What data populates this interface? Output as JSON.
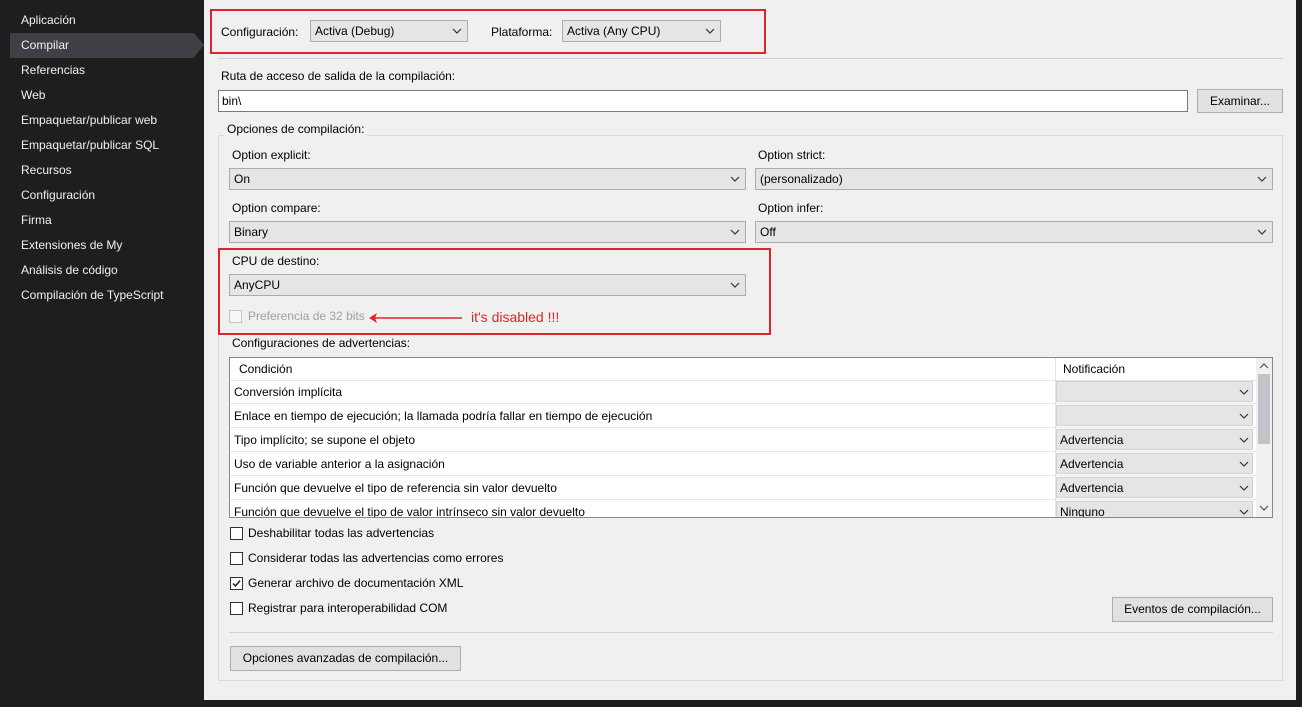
{
  "sidebar": {
    "items": [
      {
        "label": "Aplicación",
        "active": false
      },
      {
        "label": "Compilar",
        "active": true
      },
      {
        "label": "Referencias",
        "active": false
      },
      {
        "label": "Web",
        "active": false
      },
      {
        "label": "Empaquetar/publicar web",
        "active": false
      },
      {
        "label": "Empaquetar/publicar SQL",
        "active": false
      },
      {
        "label": "Recursos",
        "active": false
      },
      {
        "label": "Configuración",
        "active": false
      },
      {
        "label": "Firma",
        "active": false
      },
      {
        "label": "Extensiones de My",
        "active": false
      },
      {
        "label": "Análisis de código",
        "active": false
      },
      {
        "label": "Compilación de TypeScript",
        "active": false
      }
    ]
  },
  "top": {
    "config_label": "Configuración:",
    "config_value": "Activa (Debug)",
    "platform_label": "Plataforma:",
    "platform_value": "Activa (Any CPU)"
  },
  "output": {
    "label": "Ruta de acceso de salida de la compilación:",
    "value": "bin\\",
    "browse_button": "Examinar..."
  },
  "options": {
    "group_label": "Opciones de compilación:",
    "explicit_label": "Option explicit:",
    "explicit_value": "On",
    "strict_label": "Option strict:",
    "strict_value": "(personalizado)",
    "compare_label": "Option compare:",
    "compare_value": "Binary",
    "infer_label": "Option infer:",
    "infer_value": "Off",
    "cpu_label": "CPU de destino:",
    "cpu_value": "AnyCPU",
    "prefer32_label": "Preferencia de 32 bits",
    "prefer32_checked": false,
    "prefer32_enabled": false
  },
  "annotation": {
    "text": "it's disabled !!!",
    "color": "#e0242b"
  },
  "warnings": {
    "label": "Configuraciones de advertencias:",
    "col_condition": "Condición",
    "col_notification": "Notificación",
    "rows": [
      {
        "condition": "Conversión implícita",
        "notification": ""
      },
      {
        "condition": "Enlace en tiempo de ejecución; la llamada podría fallar en tiempo de ejecución",
        "notification": ""
      },
      {
        "condition": "Tipo implícito; se supone el objeto",
        "notification": "Advertencia"
      },
      {
        "condition": "Uso de variable anterior a la asignación",
        "notification": "Advertencia"
      },
      {
        "condition": "Función que devuelve el tipo de referencia sin valor devuelto",
        "notification": "Advertencia"
      },
      {
        "condition": "Función que devuelve el tipo de valor intrínseco sin valor devuelto",
        "notification": "Ninguno"
      }
    ]
  },
  "checks": {
    "disable_all": {
      "label": "Deshabilitar todas las advertencias",
      "checked": false
    },
    "treat_as_errors": {
      "label": "Considerar todas las advertencias como errores",
      "checked": false
    },
    "gen_xml": {
      "label": "Generar archivo de documentación XML",
      "checked": true
    },
    "com_interop": {
      "label": "Registrar para interoperabilidad COM",
      "checked": false
    }
  },
  "buttons": {
    "build_events": "Eventos de compilación...",
    "advanced": "Opciones avanzadas de compilación..."
  }
}
